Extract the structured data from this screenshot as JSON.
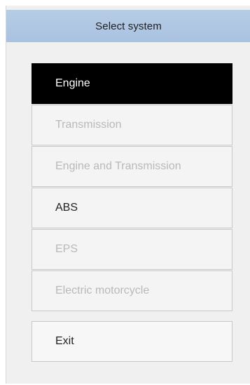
{
  "window": {
    "title": "Select system"
  },
  "menu": {
    "items": [
      {
        "label": "Engine",
        "state": "selected"
      },
      {
        "label": "Transmission",
        "state": "disabled"
      },
      {
        "label": "Engine and Transmission",
        "state": "disabled"
      },
      {
        "label": "ABS",
        "state": "enabled"
      },
      {
        "label": "EPS",
        "state": "disabled"
      },
      {
        "label": "Electric motorcycle",
        "state": "disabled"
      }
    ]
  },
  "footer": {
    "exit_label": "Exit"
  },
  "colors": {
    "titlebar": "#a9c2e0",
    "selected_bg": "#000000",
    "selected_text": "#ffffff",
    "disabled_text": "#b9b9b9",
    "enabled_text": "#222222"
  }
}
